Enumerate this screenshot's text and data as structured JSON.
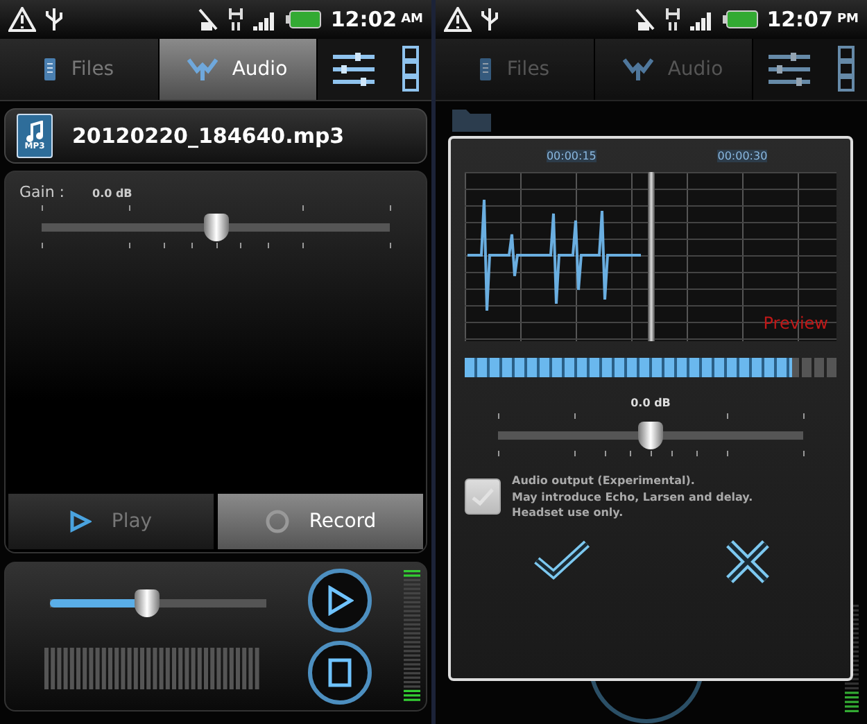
{
  "left_screen": {
    "status_bar": {
      "time": "12:02",
      "meridiem": "AM"
    },
    "tabs": [
      {
        "label": "Files",
        "selected": false
      },
      {
        "label": "Audio",
        "selected": true
      }
    ],
    "file": {
      "name": "20120220_184640.mp3",
      "badge": "MP3"
    },
    "gain": {
      "label": "Gain :",
      "reading": "0.0 dB",
      "level": 0.5
    },
    "buttons": [
      {
        "label": "Play",
        "kind": "play",
        "selected": false
      },
      {
        "label": "Record",
        "kind": "record",
        "selected": true
      }
    ],
    "player": {
      "level": 0.45
    }
  },
  "right_screen": {
    "status_bar": {
      "time": "12:07",
      "meridiem": "PM"
    },
    "dimmed": true,
    "tabs": [
      {
        "label": "Files",
        "selected": false
      },
      {
        "label": "Audio",
        "selected": false
      }
    ],
    "dialog": {
      "timeline": [
        "00:00:15",
        "00:00:30"
      ],
      "preview_label": "Preview",
      "buffer": {
        "level": 0.88
      },
      "gain": {
        "reading": "0.0 dB",
        "level": 0.5
      },
      "option": {
        "text": "Audio output (Experimental).\nMay introduce Echo, Larsen and delay.\nHeadset use only.",
        "checked": false
      }
    }
  }
}
